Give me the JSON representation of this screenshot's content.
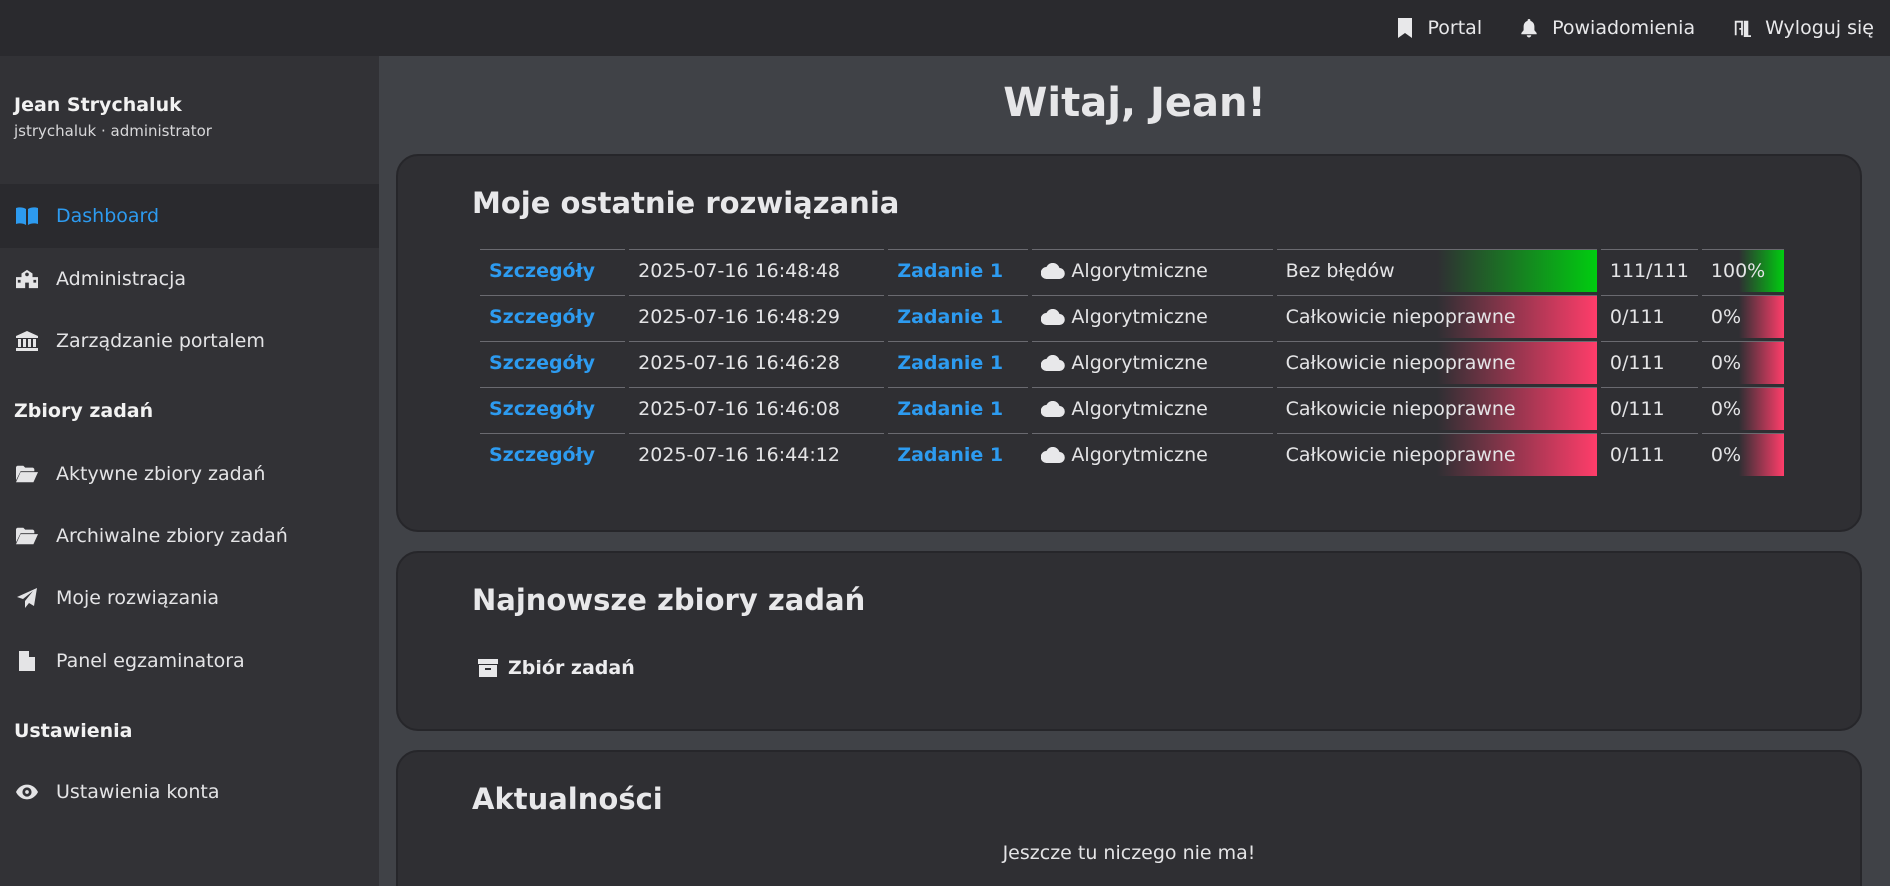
{
  "topbar": {
    "links": [
      {
        "label": "Portal",
        "icon": "bookmark-icon"
      },
      {
        "label": "Powiadomienia",
        "icon": "bell-icon"
      },
      {
        "label": "Wyloguj się",
        "icon": "door-exit-icon"
      }
    ]
  },
  "user": {
    "name": "Jean Strychaluk",
    "meta": "jstrychaluk · administrator"
  },
  "sidebar": {
    "items": [
      {
        "label": "Dashboard",
        "icon": "book-open-icon",
        "active": true
      },
      {
        "label": "Administracja",
        "icon": "school-icon"
      },
      {
        "label": "Zarządzanie portalem",
        "icon": "bank-icon"
      }
    ],
    "section_tasks": "Zbiory zadań",
    "task_items": [
      {
        "label": "Aktywne zbiory zadań",
        "icon": "folder-open-icon"
      },
      {
        "label": "Archiwalne zbiory zadań",
        "icon": "folder-open-icon"
      },
      {
        "label": "Moje rozwiązania",
        "icon": "paper-plane-icon"
      },
      {
        "label": "Panel egzaminatora",
        "icon": "file-icon"
      }
    ],
    "section_settings": "Ustawienia",
    "settings_items": [
      {
        "label": "Ustawienia konta",
        "icon": "eye-icon"
      }
    ]
  },
  "main": {
    "greeting": "Witaj, Jean!",
    "solutions": {
      "title": "Moje ostatnie rozwiązania",
      "rows": [
        {
          "details": "Szczegóły",
          "date": "2025-07-16 16:48:48",
          "task": "Zadanie 1",
          "type": "Algorytmiczne",
          "result": "Bez błędów",
          "score": "111/111",
          "percent": "100%",
          "status": "ok"
        },
        {
          "details": "Szczegóły",
          "date": "2025-07-16 16:48:29",
          "task": "Zadanie 1",
          "type": "Algorytmiczne",
          "result": "Całkowicie niepoprawne",
          "score": "0/111",
          "percent": "0%",
          "status": "bad"
        },
        {
          "details": "Szczegóły",
          "date": "2025-07-16 16:46:28",
          "task": "Zadanie 1",
          "type": "Algorytmiczne",
          "result": "Całkowicie niepoprawne",
          "score": "0/111",
          "percent": "0%",
          "status": "bad"
        },
        {
          "details": "Szczegóły",
          "date": "2025-07-16 16:46:08",
          "task": "Zadanie 1",
          "type": "Algorytmiczne",
          "result": "Całkowicie niepoprawne",
          "score": "0/111",
          "percent": "0%",
          "status": "bad"
        },
        {
          "details": "Szczegóły",
          "date": "2025-07-16 16:44:12",
          "task": "Zadanie 1",
          "type": "Algorytmiczne",
          "result": "Całkowicie niepoprawne",
          "score": "0/111",
          "percent": "0%",
          "status": "bad"
        }
      ]
    },
    "newest_sets": {
      "title": "Najnowsze zbiory zadań",
      "item": "Zbiór zadań"
    },
    "news": {
      "title": "Aktualności",
      "empty": "Jeszcze tu niczego nie ma!"
    }
  },
  "colors": {
    "accent": "#2d9bf0",
    "success": "#00cc10",
    "failure": "#ff3d6a"
  }
}
